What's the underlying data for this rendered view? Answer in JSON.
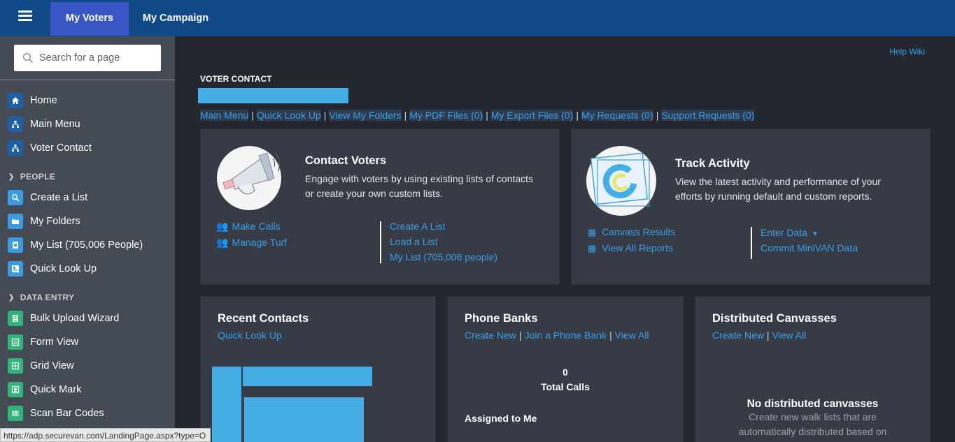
{
  "topbar": {
    "menu_icon": "hamburger-icon",
    "tabs": [
      {
        "label": "My Voters",
        "active": true
      },
      {
        "label": "My Campaign",
        "active": false
      }
    ]
  },
  "sidebar": {
    "search_placeholder": "Search for a page",
    "items_top": [
      {
        "label": "Home",
        "icon": "home-icon"
      },
      {
        "label": "Main Menu",
        "icon": "sitemap-icon"
      },
      {
        "label": "Voter Contact",
        "icon": "sitemap-icon"
      }
    ],
    "section_people": "PEOPLE",
    "items_people": [
      {
        "label": "Create a List",
        "icon": "search-icon"
      },
      {
        "label": "My Folders",
        "icon": "folder-icon"
      },
      {
        "label": "My List (705,006 People)",
        "icon": "list-icon"
      },
      {
        "label": "Quick Look Up",
        "icon": "lookup-icon"
      }
    ],
    "section_data": "DATA ENTRY",
    "items_data": [
      {
        "label": "Bulk Upload Wizard",
        "icon": "upload-icon"
      },
      {
        "label": "Form View",
        "icon": "form-icon"
      },
      {
        "label": "Grid View",
        "icon": "grid-icon"
      },
      {
        "label": "Quick Mark",
        "icon": "mark-icon"
      },
      {
        "label": "Scan Bar Codes",
        "icon": "barcode-icon"
      }
    ]
  },
  "main": {
    "help_link": "Help Wiki",
    "section_title": "VOTER CONTACT",
    "nav_links": [
      "Main Menu",
      "Quick Look Up",
      "View My Folders",
      "My PDF Files (0)",
      "My Export Files (0)",
      "My Requests (0)",
      "Support Requests (0)"
    ],
    "contact_voters": {
      "title": "Contact Voters",
      "desc_line1": "Engage with voters by using existing lists of contacts",
      "desc_line2": "or create your own custom lists.",
      "left_links": [
        "Make Calls",
        "Manage Turf"
      ],
      "right_links": [
        "Create A List",
        "Load a List",
        "My List (705,006 people)"
      ]
    },
    "track_activity": {
      "title": "Track Activity",
      "desc_line1": "View the latest activity and performance of your",
      "desc_line2": "efforts by running default and custom reports.",
      "left_links": [
        "Canvass Results",
        "View All Reports"
      ],
      "right_links": [
        "Enter Data",
        "Commit MiniVAN Data"
      ]
    },
    "recent_contacts": {
      "title": "Recent Contacts",
      "link": "Quick Look Up"
    },
    "phone_banks": {
      "title": "Phone Banks",
      "links": [
        "Create New",
        "Join a Phone Bank",
        "View All"
      ],
      "total_value": "0",
      "total_label": "Total Calls",
      "assigned": "Assigned to Me"
    },
    "distributed_canvasses": {
      "title": "Distributed Canvasses",
      "links": [
        "Create New",
        "View All"
      ],
      "empty_title": "No distributed canvasses",
      "empty_line1": "Create new walk lists that are",
      "empty_line2": "automatically distributed based on"
    }
  },
  "statusbar": {
    "url": "https://adp.securevan.com/LandingPage.aspx?type=O"
  }
}
